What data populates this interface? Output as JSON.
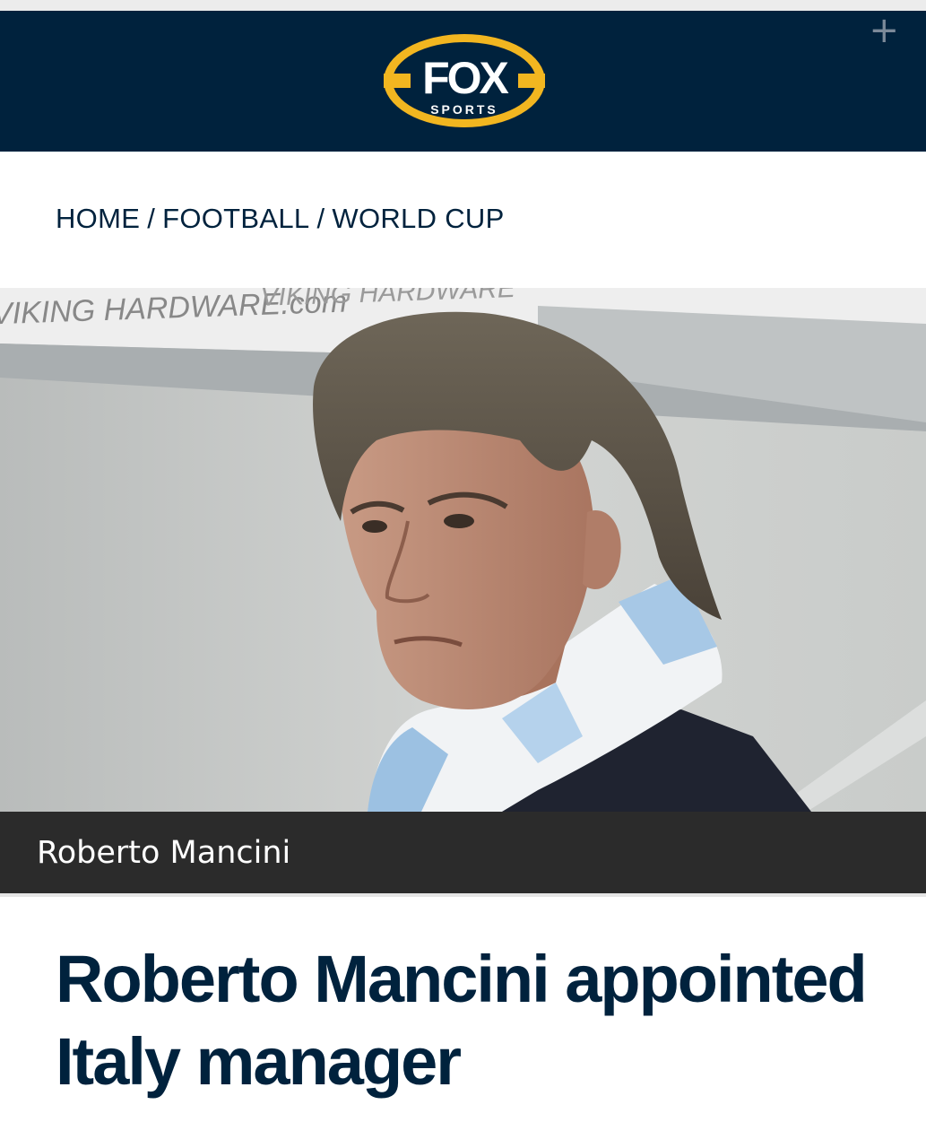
{
  "header": {
    "logo": {
      "main": "FOX",
      "sub": "SPORTS",
      "ring_color": "#f2b620",
      "bg_color": "#00223d"
    },
    "plus_label": "+"
  },
  "breadcrumb": {
    "items": [
      "HOME",
      "FOOTBALL",
      "WORLD CUP"
    ],
    "separator": "/"
  },
  "hero": {
    "banner_text_1": "VIKING HARDWARE.com",
    "banner_text_2": "VIKING HARDWARE"
  },
  "caption": {
    "text": "Roberto Mancini"
  },
  "article": {
    "headline": "Roberto Mancini appointed Italy manager"
  },
  "colors": {
    "navy": "#00223d",
    "caption_bg": "#2b2b2b"
  }
}
